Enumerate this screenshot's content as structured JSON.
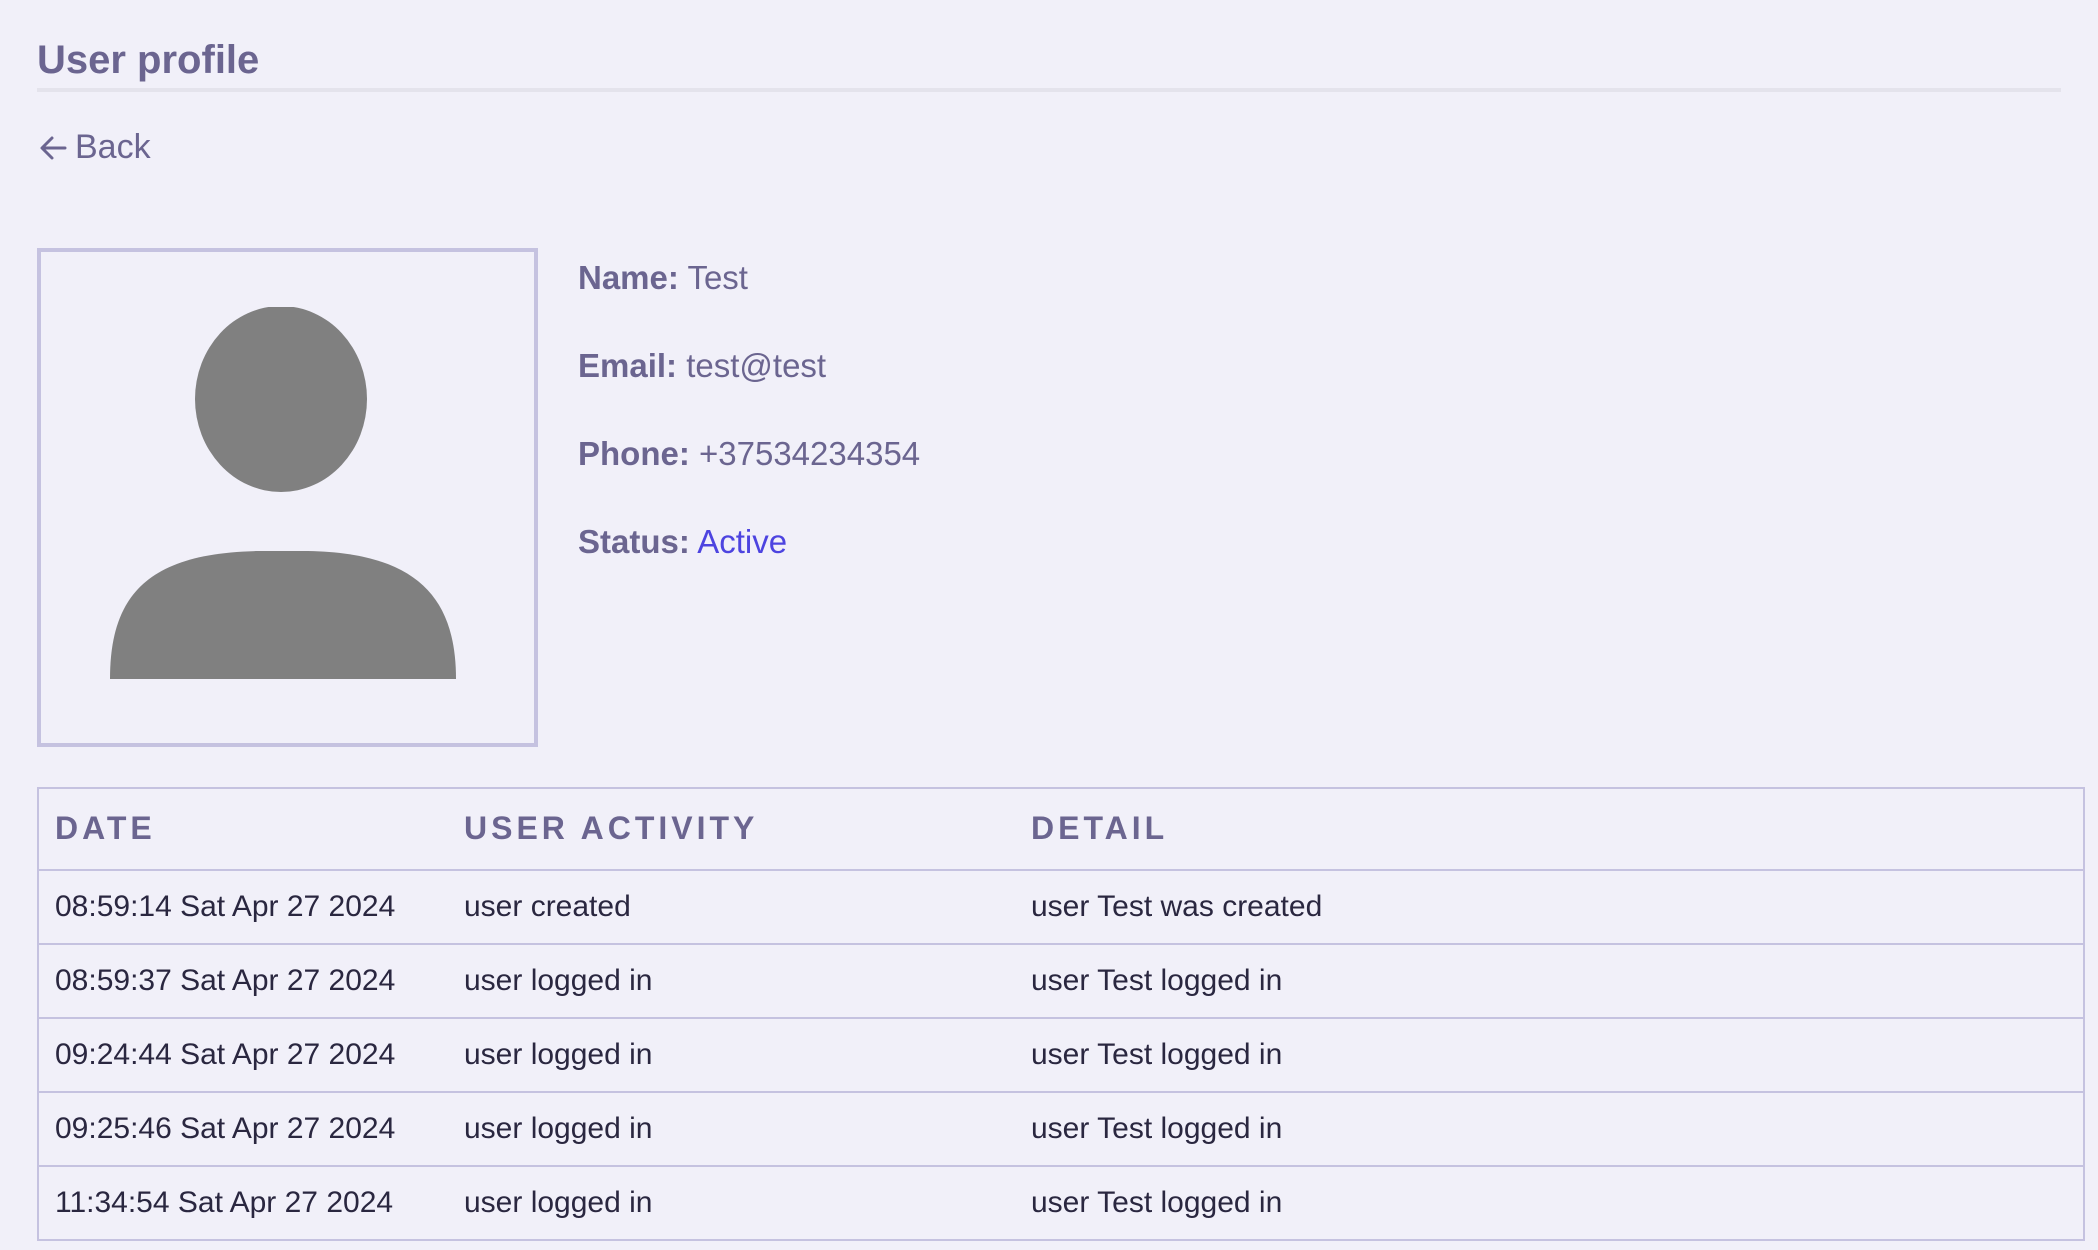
{
  "page": {
    "title": "User profile",
    "back_label": "Back"
  },
  "profile": {
    "name_label": "Name:",
    "name_value": "Test",
    "email_label": "Email:",
    "email_value": "test@test",
    "phone_label": "Phone:",
    "phone_value": "+37534234354",
    "status_label": "Status:",
    "status_value": "Active",
    "status_color": "#4d44e0",
    "avatar_icon": "user-silhouette-icon"
  },
  "table": {
    "headers": [
      "DATE",
      "USER ACTIVITY",
      "DETAIL"
    ],
    "rows": [
      [
        "08:59:14 Sat Apr 27 2024",
        "user created",
        "user Test was created"
      ],
      [
        "08:59:37 Sat Apr 27 2024",
        "user logged in",
        "user Test logged in"
      ],
      [
        "09:24:44 Sat Apr 27 2024",
        "user logged in",
        "user Test logged in"
      ],
      [
        "09:25:46 Sat Apr 27 2024",
        "user logged in",
        "user Test logged in"
      ],
      [
        "11:34:54 Sat Apr 27 2024",
        "user logged in",
        "user Test logged in"
      ]
    ]
  },
  "colors": {
    "background": "#f1f0f9",
    "text_muted": "#6b6590",
    "border": "#c5c2e0",
    "accent": "#4d44e0"
  }
}
